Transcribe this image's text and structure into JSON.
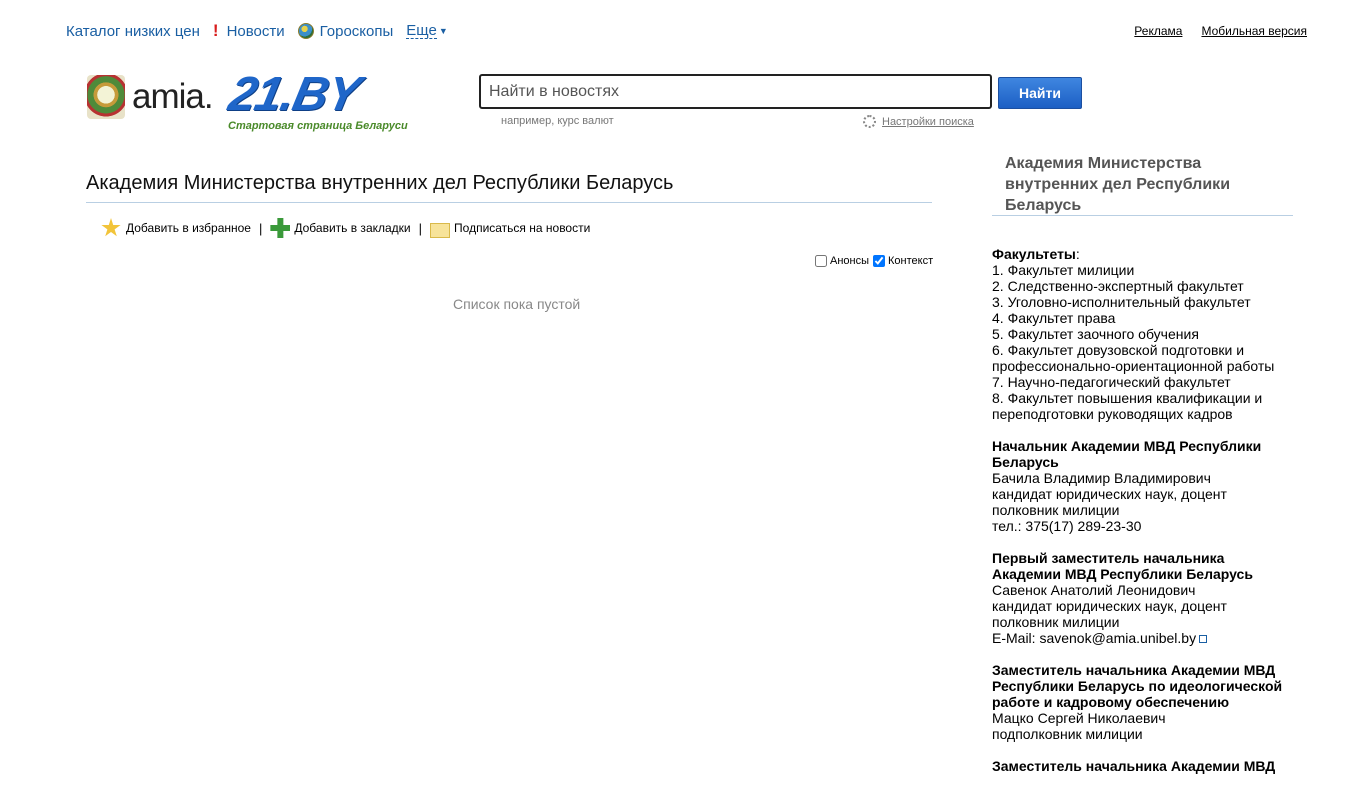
{
  "topnav": {
    "catalog": "Каталог низких цен",
    "news": "Новости",
    "horoscopes": "Гороскопы",
    "more": "Еще"
  },
  "toplinks": {
    "ads": "Реклама",
    "mobile": "Мобильная версия"
  },
  "logo": {
    "amia": "amia.",
    "site": "21.BY",
    "tagline": "Стартовая страница Беларуси"
  },
  "search": {
    "placeholder": "Найти в новостях",
    "button": "Найти",
    "hint": "например, курс валют",
    "settings": "Настройки поиска"
  },
  "main": {
    "title": "Академия Министерства внутренних дел Республики Беларусь",
    "actions": {
      "favorite": "Добавить в избранное",
      "bookmark": "Добавить в закладки",
      "subscribe": "Подписаться на новости",
      "separator": "|"
    },
    "filters": {
      "announcements": "Анонсы",
      "announcements_checked": false,
      "context": "Контекст",
      "context_checked": true
    },
    "empty": "Список пока пустой"
  },
  "sidebar": {
    "title": "Академия Министерства внутренних дел Республики Беларусь",
    "faculties_heading": "Факультеты",
    "faculties": [
      "1.  Факультет милиции",
      "2.  Следственно-экспертный факультет",
      "3.  Уголовно-исполнительный факультет",
      "4.  Факультет права",
      "5.  Факультет заочного обучения",
      "6.  Факультет довузовской подготовки и профессионально-ориентационной работы",
      "7.  Научно-педагогический факультет",
      "8.  Факультет повышения квалификации и переподготовки руководящих кадров"
    ],
    "head": {
      "position": "Начальник Академии МВД Республики Беларусь",
      "name": "Бачила Владимир Владимирович",
      "degree": "кандидат юридических наук, доцент",
      "rank": "полковник милиции",
      "phone": "тел.: 375(17) 289-23-30"
    },
    "deputy1": {
      "position": "Первый заместитель начальника Академии МВД Республики Беларусь",
      "name": "Савенок Анатолий Леонидович",
      "degree": "кандидат юридических наук, доцент",
      "rank": "полковник милиции",
      "email": "E-Mail: savenok@amia.unibel.by"
    },
    "deputy2": {
      "position": "Заместитель начальника Академии МВД Республики Беларусь по идеологической работе и кадровому обеспечению",
      "name": "Мацко Сергей Николаевич",
      "rank": "подполковник милиции"
    },
    "deputy3": {
      "position": "Заместитель начальника Академии МВД"
    }
  }
}
